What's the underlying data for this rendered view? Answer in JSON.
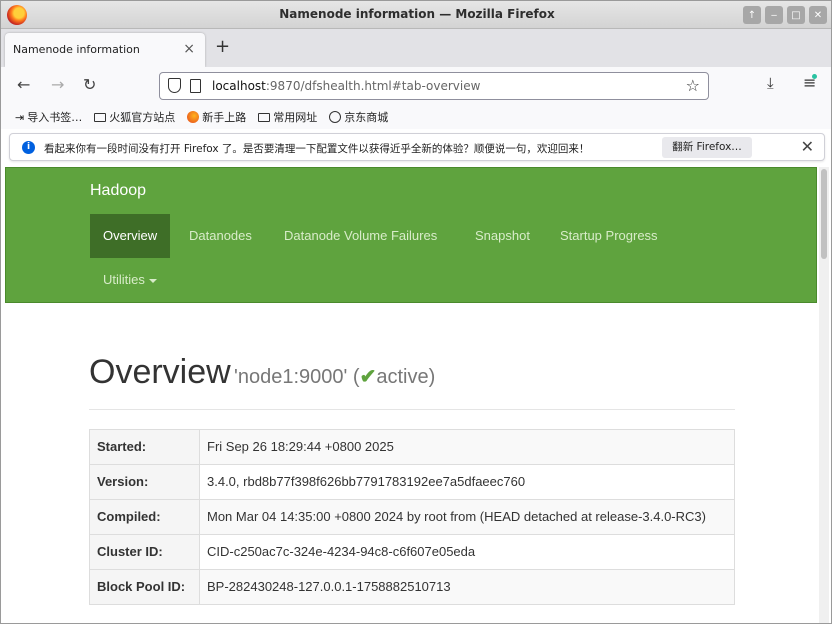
{
  "window": {
    "title": "Namenode information — Mozilla Firefox"
  },
  "tabs": [
    {
      "label": "Namenode information"
    }
  ],
  "address": {
    "host": "localhost",
    "rest": ":9870/dfshealth.html#tab-overview"
  },
  "bookmarks": [
    {
      "label": "导入书签…",
      "icon": "import-icon"
    },
    {
      "label": "火狐官方站点",
      "icon": "folder-icon"
    },
    {
      "label": "新手上路",
      "icon": "firefox-icon"
    },
    {
      "label": "常用网址",
      "icon": "folder-icon"
    },
    {
      "label": "京东商城",
      "icon": "globe-icon"
    }
  ],
  "notification": {
    "text": "看起来你有一段时间没有打开 Firefox 了。是否要清理一下配置文件以获得近乎全新的体验？顺便说一句，欢迎回来！",
    "button": "翻新 Firefox…"
  },
  "hadoop": {
    "brand": "Hadoop",
    "nav": [
      "Overview",
      "Datanodes",
      "Datanode Volume Failures",
      "Snapshot",
      "Startup Progress"
    ],
    "utilities": "Utilities",
    "heading": "Overview",
    "node": "'node1:9000'",
    "status": "active",
    "table": [
      {
        "key": "Started:",
        "value": "Fri Sep 26 18:29:44 +0800 2025"
      },
      {
        "key": "Version:",
        "value": "3.4.0, rbd8b77f398f626bb7791783192ee7a5dfaeec760"
      },
      {
        "key": "Compiled:",
        "value": "Mon Mar 04 14:35:00 +0800 2024 by root from (HEAD detached at release-3.4.0-RC3)"
      },
      {
        "key": "Cluster ID:",
        "value": "CID-c250ac7c-324e-4234-94c8-c6f607e05eda"
      },
      {
        "key": "Block Pool ID:",
        "value": "BP-282430248-127.0.0.1-1758882510713"
      }
    ]
  },
  "colors": {
    "hadoop_green": "#5fa33e",
    "active_nav": "#3e6e27"
  }
}
